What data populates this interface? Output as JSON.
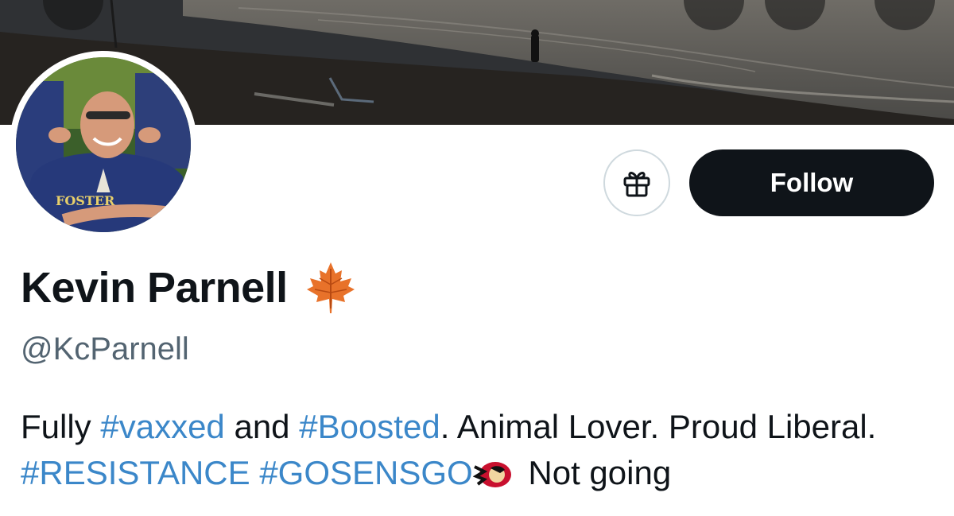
{
  "profile": {
    "name": "Kevin Parnell",
    "handle": "@KcParnell",
    "follow_label": "Follow",
    "bio": {
      "t1": "Fully ",
      "tag_vaxxed": "#vaxxed",
      "t2": " and ",
      "tag_boosted": "#Boosted",
      "t3": ". Animal Lover. Proud Liberal. ",
      "tag_resistance": "#RESISTANCE",
      "t4": " ",
      "tag_gosensgo": "#GOSENSGO",
      "t5": " Not going"
    }
  },
  "icons": {
    "header": [
      "partial-round-button-icon",
      "search-icon",
      "more-icon"
    ],
    "gift": "gift-icon",
    "leaf": "maple-leaf-emoji",
    "sens": "ottawa-senators-logo-emoji"
  },
  "colors": {
    "link": "#3b87c9",
    "text": "#0f1419",
    "secondary": "#536471",
    "follow_bg": "#0f1419"
  }
}
